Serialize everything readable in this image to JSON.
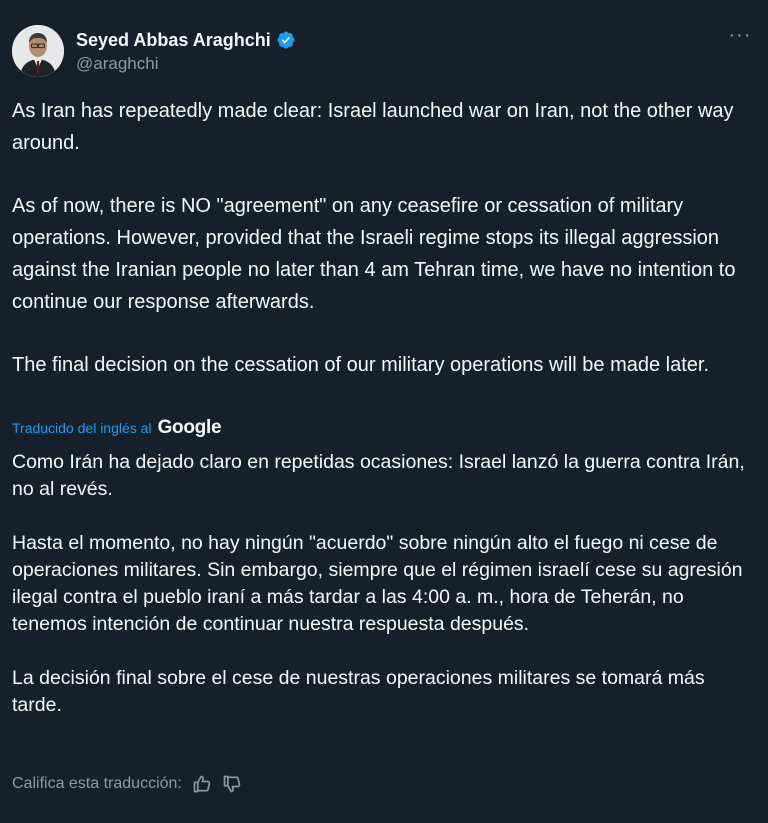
{
  "author": {
    "name": "Seyed Abbas Araghchi",
    "handle": "@araghchi",
    "avatar_icon": "profile-photo",
    "verified_color": "#1d9bf0"
  },
  "more_label": "···",
  "tweet": {
    "paragraphs": [
      "As Iran has repeatedly made clear: Israel launched war on Iran, not the other way around.",
      "As of now, there is NO \"agreement\" on any ceasefire or cessation of military operations. However, provided that the Israeli regime stops its illegal aggression against the Iranian people no later than 4 am Tehran time, we have no intention to continue our response afterwards.",
      "The final decision on the cessation of our military operations will be made later."
    ]
  },
  "translation": {
    "label": "Traducido del inglés al",
    "provider": "Google",
    "paragraphs": [
      "Como Irán ha dejado claro en repetidas ocasiones: Israel lanzó la guerra contra Irán, no al revés.",
      "Hasta el momento, no hay ningún \"acuerdo\" sobre ningún alto el fuego ni cese de operaciones militares. Sin embargo, siempre que el régimen israelí cese su agresión ilegal contra el pueblo iraní a más tardar a las 4:00 a. m., hora de Teherán, no tenemos intención de continuar nuestra respuesta después.",
      "La decisión final sobre el cese de nuestras operaciones militares se tomará más tarde."
    ],
    "rate_label": "Califica esta traducción:",
    "rate_icons": [
      "thumbs-up-icon",
      "thumbs-down-icon"
    ]
  },
  "colors": {
    "background": "#15202b",
    "text": "#f7f9f9",
    "muted": "#8b98a5",
    "accent": "#1d9bf0"
  }
}
